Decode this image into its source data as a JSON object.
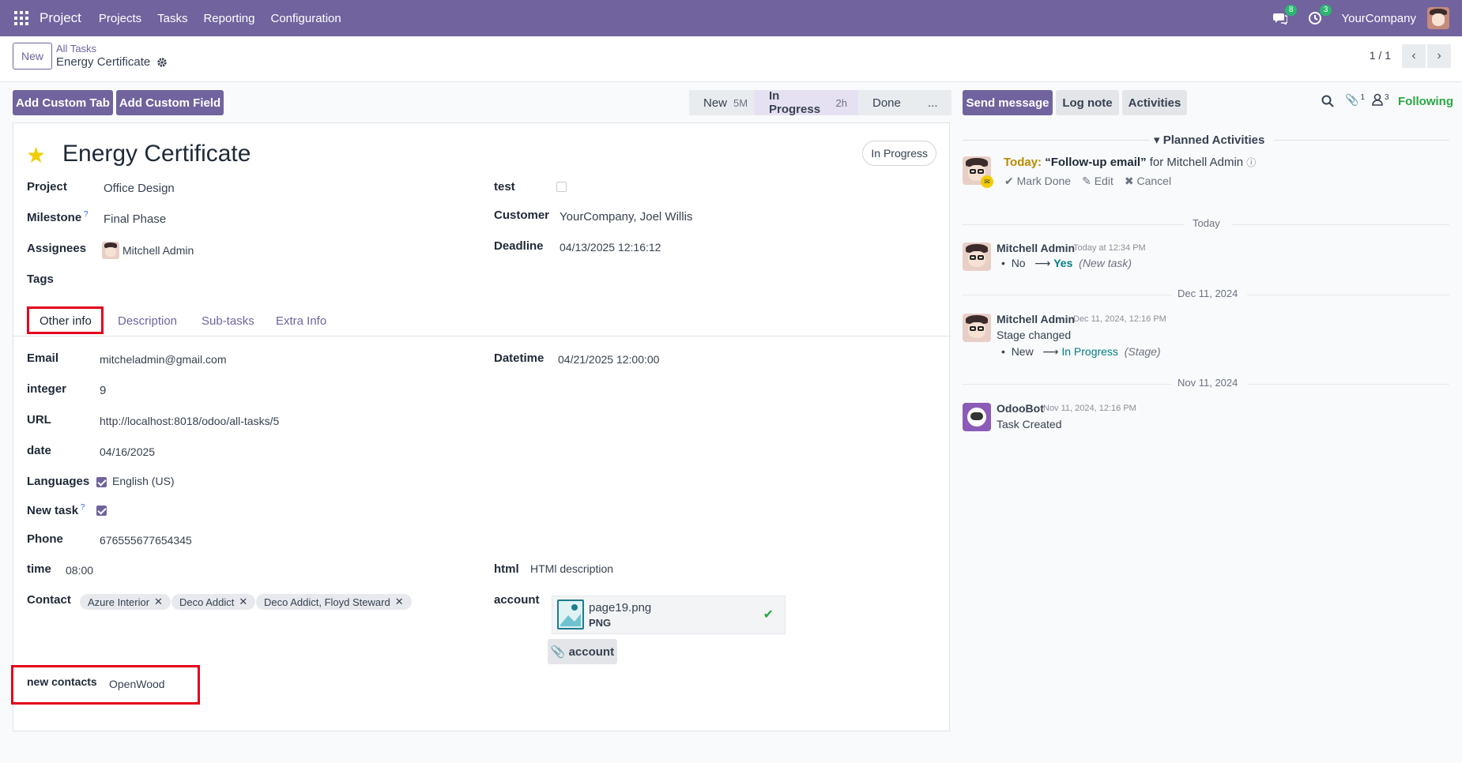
{
  "navbar": {
    "app_name": "Project",
    "menu": [
      "Projects",
      "Tasks",
      "Reporting",
      "Configuration"
    ],
    "messages_badge": "8",
    "activities_badge": "3",
    "company": "YourCompany"
  },
  "control_panel": {
    "new_label": "New",
    "breadcrumb_parent": "All Tasks",
    "breadcrumb_current": "Energy Certificate",
    "pager": "1 / 1"
  },
  "actions": {
    "add_custom_tab": "Add Custom Tab",
    "add_custom_field": "Add Custom Field"
  },
  "statusbar": {
    "stages": [
      {
        "label": "New",
        "sub": "5M"
      },
      {
        "label": "In Progress",
        "sub": "2h"
      },
      {
        "label": "Done",
        "sub": ""
      },
      {
        "label": "...",
        "sub": ""
      }
    ]
  },
  "task": {
    "title": "Energy Certificate",
    "stage_pill": "In Progress",
    "fields": {
      "project_label": "Project",
      "project": "Office Design",
      "milestone_label": "Milestone",
      "milestone": "Final Phase",
      "assignees_label": "Assignees",
      "assignee": "Mitchell Admin",
      "tags_label": "Tags",
      "test_label": "test",
      "customer_label": "Customer",
      "customer": "YourCompany, Joel Willis",
      "deadline_label": "Deadline",
      "deadline": "04/13/2025 12:16:12"
    },
    "tabs": [
      "Other info",
      "Description",
      "Sub-tasks",
      "Extra Info"
    ],
    "other_info": {
      "email_label": "Email",
      "email": "mitcheladmin@gmail.com",
      "integer_label": "integer",
      "integer": "9",
      "url_label": "URL",
      "url": "http://localhost:8018/odoo/all-tasks/5",
      "date_label": "date",
      "date": "04/16/2025",
      "languages_label": "Languages",
      "language": "English (US)",
      "new_task_label": "New task",
      "phone_label": "Phone",
      "phone": "676555677654345",
      "time_label": "time",
      "time": "08:00",
      "contact_label": "Contact",
      "contacts": [
        "Azure Interior",
        "Deco Addict",
        "Deco Addict, Floyd Steward"
      ],
      "new_contacts_label": "new contacts",
      "new_contacts": "OpenWood",
      "datetime_label": "Datetime",
      "datetime": "04/21/2025 12:00:00",
      "html_label": "html",
      "html": "HTMl description",
      "account_label": "account",
      "attachment_name": "page19.png",
      "attachment_ext": "PNG",
      "account_button": "account"
    }
  },
  "chatter": {
    "send_message": "Send message",
    "log_note": "Log note",
    "activities": "Activities",
    "attachments_count": "1",
    "followers_count": "3",
    "following": "Following",
    "planned_title": "Planned Activities",
    "activity": {
      "today": "Today:",
      "summary": "“Follow-up email”",
      "for": "for Mitchell Admin",
      "mark_done": "Mark Done",
      "edit": "Edit",
      "cancel": "Cancel"
    },
    "sep_today": "Today",
    "msg1": {
      "author": "Mitchell Admin",
      "time": "Today at 12:34 PM",
      "old": "No",
      "new": "Yes",
      "field": "(New task)"
    },
    "sep_dec": "Dec 11, 2024",
    "msg2": {
      "author": "Mitchell Admin",
      "time": "Dec 11, 2024, 12:16 PM",
      "text": "Stage changed",
      "old": "New",
      "new": "In Progress",
      "field": "(Stage)"
    },
    "sep_nov": "Nov 11, 2024",
    "msg3": {
      "author": "OdooBot",
      "time": "Nov 11, 2024, 12:16 PM",
      "text": "Task Created"
    }
  },
  "colors": {
    "brand": "#71639e",
    "highlight": "#e3001b",
    "following": "#28a745"
  }
}
